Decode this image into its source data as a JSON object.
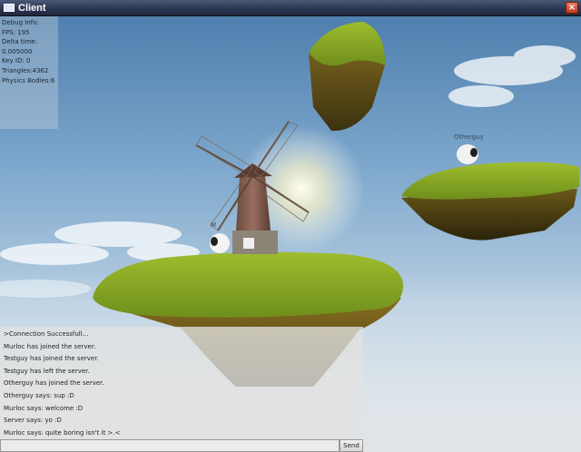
{
  "window": {
    "title": "Client",
    "close_glyph": "×"
  },
  "debug": {
    "lines": [
      "Debug Info:",
      "FPS: 195",
      "Delta time:",
      "0.005000",
      "Key ID: 0",
      "Triangles:4362",
      "Physics Bodies:6"
    ]
  },
  "players": {
    "local_tag": "M",
    "other_tag": "Otherguy"
  },
  "chat": {
    "messages": [
      ">Connection Successfull...",
      "Murloc has joined the server.",
      "Testguy has joined the server.",
      "Testguy has left the server.",
      "Otherguy has joined the server.",
      "Otherguy says: sup :D",
      "Murloc says: welcome :D",
      "Server says: yo :D",
      "Murloc says: quite boring isn't it >.<"
    ],
    "input_value": "",
    "send_label": "Send"
  },
  "icons": {
    "window_icon": "window-icon",
    "close": "close-icon"
  },
  "colors": {
    "titlebar": "#2a3550",
    "close_button": "#c5361c",
    "grass": "#8fae2a",
    "sky_top": "#4f7fae"
  }
}
